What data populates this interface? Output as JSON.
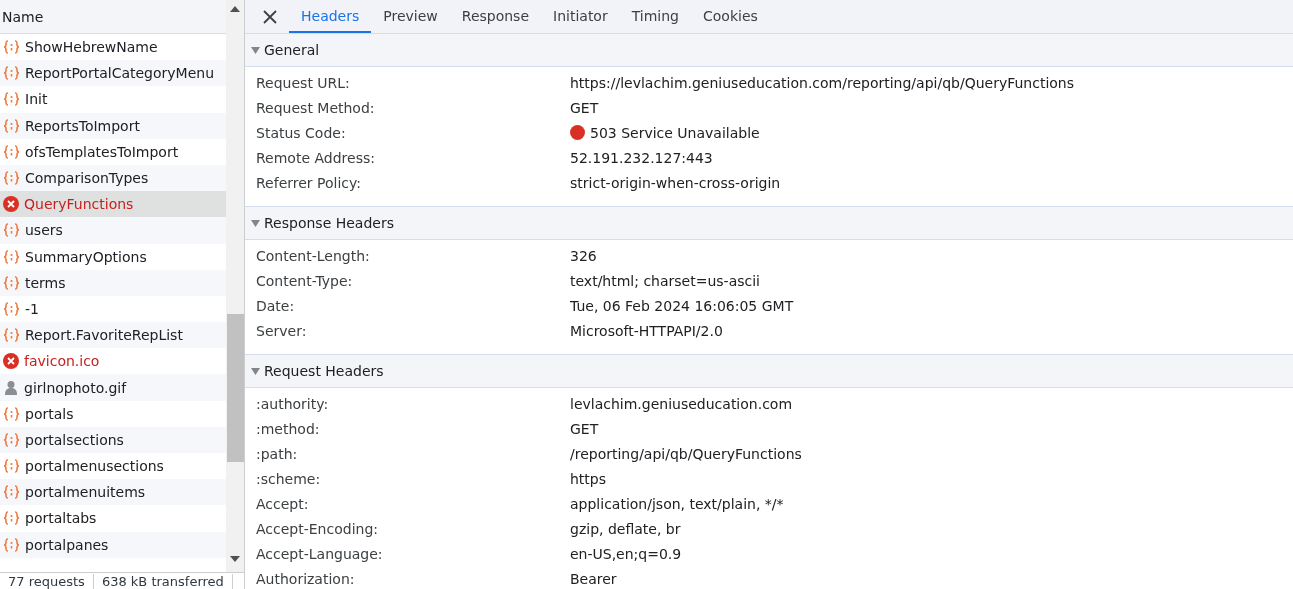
{
  "request_list": {
    "column_header": "Name",
    "rows": [
      {
        "name": "ShowHebrewName",
        "kind": "xhr",
        "selected": false
      },
      {
        "name": "ReportPortalCategoryMenu",
        "kind": "xhr",
        "selected": false
      },
      {
        "name": "Init",
        "kind": "xhr",
        "selected": false
      },
      {
        "name": "ReportsToImport",
        "kind": "xhr",
        "selected": false
      },
      {
        "name": "ofsTemplatesToImport",
        "kind": "xhr",
        "selected": false
      },
      {
        "name": "ComparisonTypes",
        "kind": "xhr",
        "selected": false
      },
      {
        "name": "QueryFunctions",
        "kind": "error",
        "selected": true
      },
      {
        "name": "users",
        "kind": "xhr",
        "selected": false
      },
      {
        "name": "SummaryOptions",
        "kind": "xhr",
        "selected": false
      },
      {
        "name": "terms",
        "kind": "xhr",
        "selected": false
      },
      {
        "name": "-1",
        "kind": "xhr",
        "selected": false
      },
      {
        "name": "Report.FavoriteRepList",
        "kind": "xhr",
        "selected": false
      },
      {
        "name": "favicon.ico",
        "kind": "error",
        "selected": false
      },
      {
        "name": "girlnophoto.gif",
        "kind": "image",
        "selected": false
      },
      {
        "name": "portals",
        "kind": "xhr",
        "selected": false
      },
      {
        "name": "portalsections",
        "kind": "xhr",
        "selected": false
      },
      {
        "name": "portalmenusections",
        "kind": "xhr",
        "selected": false
      },
      {
        "name": "portalmenuitems",
        "kind": "xhr",
        "selected": false
      },
      {
        "name": "portaltabs",
        "kind": "xhr",
        "selected": false
      },
      {
        "name": "portalpanes",
        "kind": "xhr",
        "selected": false
      }
    ]
  },
  "status_bar": {
    "requests": "77 requests",
    "transferred": "638 kB transferred"
  },
  "detail_tabs": [
    {
      "label": "Headers",
      "selected": true
    },
    {
      "label": "Preview",
      "selected": false
    },
    {
      "label": "Response",
      "selected": false
    },
    {
      "label": "Initiator",
      "selected": false
    },
    {
      "label": "Timing",
      "selected": false
    },
    {
      "label": "Cookies",
      "selected": false
    }
  ],
  "sections": [
    {
      "title": "General",
      "expanded": true,
      "rows": [
        {
          "name": "Request URL:",
          "value": "https://levlachim.geniuseducation.com/reporting/api/qb/QueryFunctions"
        },
        {
          "name": "Request Method:",
          "value": "GET"
        },
        {
          "name": "Status Code:",
          "value": "503 Service Unavailable",
          "color": "#d93025"
        },
        {
          "name": "Remote Address:",
          "value": "52.191.232.127:443"
        },
        {
          "name": "Referrer Policy:",
          "value": "strict-origin-when-cross-origin"
        }
      ]
    },
    {
      "title": "Response Headers",
      "expanded": true,
      "rows": [
        {
          "name": "Content-Length:",
          "value": "326"
        },
        {
          "name": "Content-Type:",
          "value": "text/html; charset=us-ascii"
        },
        {
          "name": "Date:",
          "value": "Tue, 06 Feb 2024 16:06:05 GMT"
        },
        {
          "name": "Server:",
          "value": "Microsoft-HTTPAPI/2.0"
        }
      ]
    },
    {
      "title": "Request Headers",
      "expanded": true,
      "rows": [
        {
          "name": ":authority:",
          "value": "levlachim.geniuseducation.com"
        },
        {
          "name": ":method:",
          "value": "GET"
        },
        {
          "name": ":path:",
          "value": "/reporting/api/qb/QueryFunctions"
        },
        {
          "name": ":scheme:",
          "value": "https"
        },
        {
          "name": "Accept:",
          "value": "application/json, text/plain, */*"
        },
        {
          "name": "Accept-Encoding:",
          "value": "gzip, deflate, br"
        },
        {
          "name": "Accept-Language:",
          "value": "en-US,en;q=0.9"
        },
        {
          "name": "Authorization:",
          "value": "Bearer"
        }
      ]
    }
  ]
}
